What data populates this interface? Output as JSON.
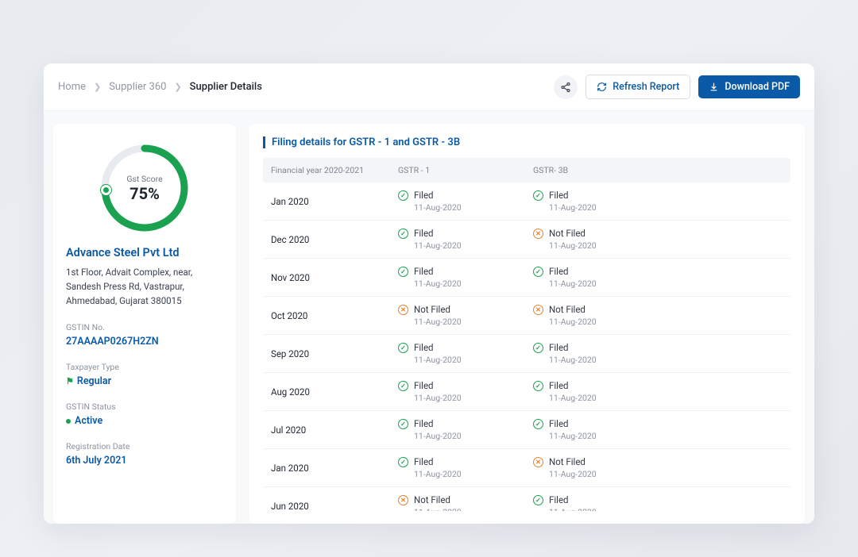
{
  "breadcrumbs": {
    "home": "Home",
    "mid": "Supplier 360",
    "current": "Supplier Details"
  },
  "actions": {
    "refresh": "Refresh Report",
    "download": "Download PDF"
  },
  "score": {
    "label": "Gst Score",
    "value": "75%",
    "pct": 0.75
  },
  "supplier": {
    "name": "Advance Steel Pvt Ltd",
    "address": "1st Floor, Advait Complex, near, Sandesh Press Rd, Vastrapur, Ahmedabad, Gujarat 380015",
    "gstin_label": "GSTIN No.",
    "gstin": "27AAAAP0267H2ZN",
    "taxpayer_type_label": "Taxpayer Type",
    "taxpayer_type": "Regular",
    "status_label": "GSTIN Status",
    "status": "Active",
    "regdate_label": "Registration Date",
    "regdate": "6th July 2021"
  },
  "table": {
    "title": "Filing details for GSTR - 1 and GSTR - 3B",
    "col_fy": "Financial year 2020-2021",
    "col_g1": "GSTR - 1",
    "col_g3b": "GSTR- 3B",
    "filed": "Filed",
    "not_filed": "Not Filed",
    "date": "11-Aug-2020",
    "rows": [
      {
        "m": "Jan 2020",
        "g1": true,
        "g3b": true
      },
      {
        "m": "Dec 2020",
        "g1": true,
        "g3b": false
      },
      {
        "m": "Nov 2020",
        "g1": true,
        "g3b": true
      },
      {
        "m": "Oct 2020",
        "g1": false,
        "g3b": false
      },
      {
        "m": "Sep 2020",
        "g1": true,
        "g3b": true
      },
      {
        "m": "Aug 2020",
        "g1": true,
        "g3b": true
      },
      {
        "m": "Jul 2020",
        "g1": true,
        "g3b": true
      },
      {
        "m": "Jan 2020",
        "g1": true,
        "g3b": false
      },
      {
        "m": "Jun 2020",
        "g1": false,
        "g3b": true
      }
    ]
  }
}
